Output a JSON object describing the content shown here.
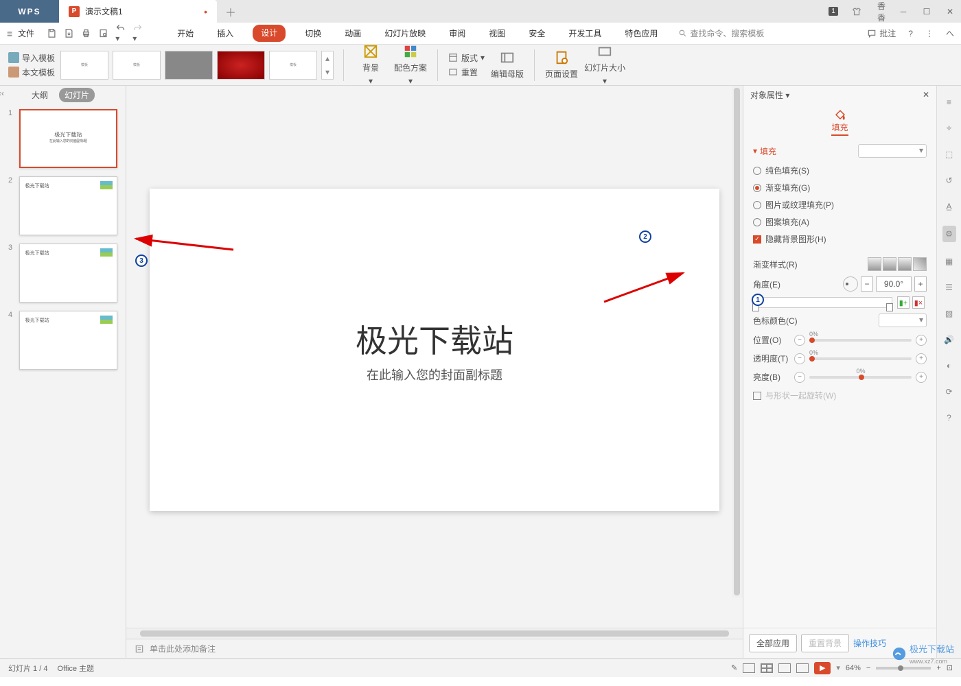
{
  "titlebar": {
    "wps": "WPS",
    "tab_name": "演示文稿1",
    "user": "香香",
    "badge": "1"
  },
  "menu": {
    "file": "文件",
    "tabs": [
      "开始",
      "插入",
      "设计",
      "切换",
      "动画",
      "幻灯片放映",
      "审阅",
      "视图",
      "安全",
      "开发工具",
      "特色应用"
    ],
    "active": 2,
    "search": "查找命令、搜索模板",
    "comment": "批注"
  },
  "ribbon": {
    "import_tmpl": "导入模板",
    "this_tmpl": "本文模板",
    "bg": "背景",
    "scheme": "配色方案",
    "format": "版式",
    "reset": "重置",
    "master": "编辑母版",
    "page_setup": "页面设置",
    "slide_size": "幻灯片大小"
  },
  "panes": {
    "outline": "大纲",
    "slides": "幻灯片"
  },
  "thumbs": [
    {
      "n": "1",
      "title": "极光下载站",
      "sub": "在此输入您的封面副标题"
    },
    {
      "n": "2",
      "title": "极光下载站"
    },
    {
      "n": "3",
      "title": "极光下载站"
    },
    {
      "n": "4",
      "title": "极光下载站"
    }
  ],
  "slide": {
    "title": "极光下载站",
    "subtitle": "在此输入您的封面副标题"
  },
  "notes": "单击此处添加备注",
  "props": {
    "title": "对象属性",
    "fill_tab": "填充",
    "fill_section": "填充",
    "solid": "纯色填充(S)",
    "gradient": "渐变填充(G)",
    "picture": "图片或纹理填充(P)",
    "pattern": "图案填充(A)",
    "hide_bg": "隐藏背景图形(H)",
    "grad_style": "渐变样式(R)",
    "angle": "角度(E)",
    "angle_val": "90.0°",
    "stop_color": "色标颜色(C)",
    "position": "位置(O)",
    "transparency": "透明度(T)",
    "brightness": "亮度(B)",
    "rotate_with": "与形状一起旋转(W)",
    "pos_pct": "0%",
    "trans_pct": "0%",
    "bright_pct": "0%",
    "apply_all": "全部应用",
    "reset_bg": "重置背景",
    "tips": "操作技巧"
  },
  "status": {
    "slide": "幻灯片 1 / 4",
    "theme": "Office 主题",
    "zoom": "64%"
  },
  "watermark": {
    "name": "极光下载站",
    "url": "www.xz7.com"
  }
}
